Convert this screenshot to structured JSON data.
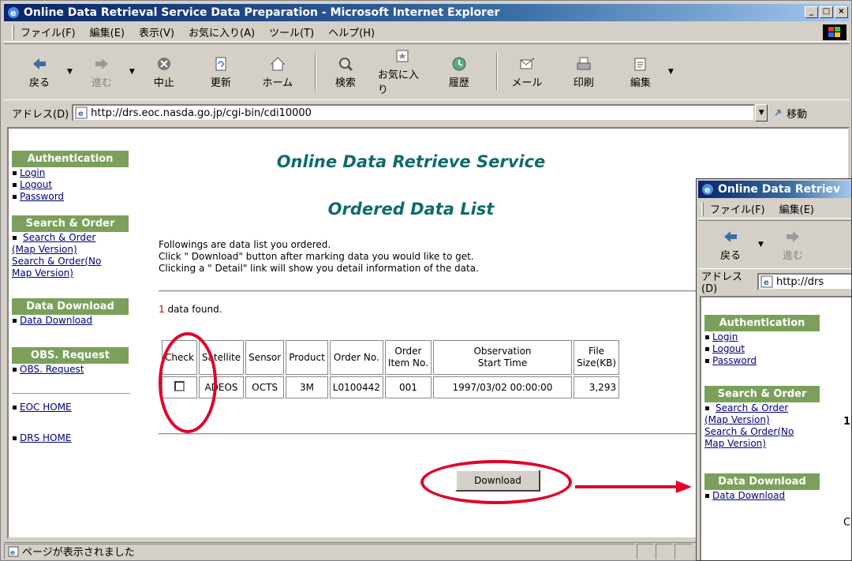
{
  "window": {
    "title": "Online Data Retrieval Service Data Preparation - Microsoft Internet Explorer",
    "controls": [
      "_",
      "□",
      "×"
    ]
  },
  "menu": [
    "ファイル(F)",
    "編集(E)",
    "表示(V)",
    "お気に入り(A)",
    "ツール(T)",
    "ヘルプ(H)"
  ],
  "toolbar": {
    "back": "戻る",
    "forward": "進む",
    "stop": "中止",
    "refresh": "更新",
    "home": "ホーム",
    "search": "検索",
    "favorites": "お気に入り",
    "history": "履歴",
    "mail": "メール",
    "print": "印刷",
    "edit": "編集"
  },
  "address": {
    "label": "アドレス(D)",
    "url": "http://drs.eoc.nasda.go.jp/cgi-bin/cdi10000",
    "go": "移動"
  },
  "sidebar": {
    "auth_head": "Authentication",
    "login": "Login",
    "logout": "Logout",
    "password": "Password",
    "search_head": "Search & Order",
    "search_map_1": "Search & Order",
    "search_map_2": "(Map Version)",
    "search_nomap_1": "Search & Order(No",
    "search_nomap_2": "Map Version)",
    "download_head": "Data Download",
    "download": "Data Download",
    "obs_head": "OBS. Request",
    "obs": "OBS. Request",
    "eoc": "EOC HOME",
    "drs": "DRS HOME"
  },
  "page": {
    "title": "Online Data Retrieve Service",
    "subtitle": "Ordered Data List",
    "intro1": "Followings are data list you ordered.",
    "intro2": "Click \" Download\" button after marking data you would like to get.",
    "intro3": "Clicking a \" Detail\" link will show you detail information of the data.",
    "found_count": "1",
    "found_text": " data found.",
    "download_button": "Download"
  },
  "table": {
    "headers": [
      "Check",
      "Satellite",
      "Sensor",
      "Product",
      "Order No.",
      "Order\nItem No.",
      "Observation\nStart Time",
      "File\nSize(KB)"
    ],
    "rows": [
      {
        "checked": false,
        "satellite": "ADEOS",
        "sensor": "OCTS",
        "product": "3M",
        "order_no": "L0100442",
        "item_no": "001",
        "start_time": "1997/03/02 00:00:00",
        "size": "3,293"
      }
    ]
  },
  "status": {
    "text": "ページが表示されました"
  },
  "inset": {
    "title": "Online Data Retriev",
    "menu": [
      "ファイル(F)",
      "編集(E)"
    ],
    "back": "戻る",
    "forward": "進む",
    "address_label": "アドレス(D)",
    "url": "http://drs",
    "partial1": "1",
    "partial2": "C"
  },
  "colors": {
    "accent_green": "#7ba05b",
    "title_teal": "#0f6b6b",
    "highlight_red": "#e0002a",
    "link_blue": "#000080"
  }
}
